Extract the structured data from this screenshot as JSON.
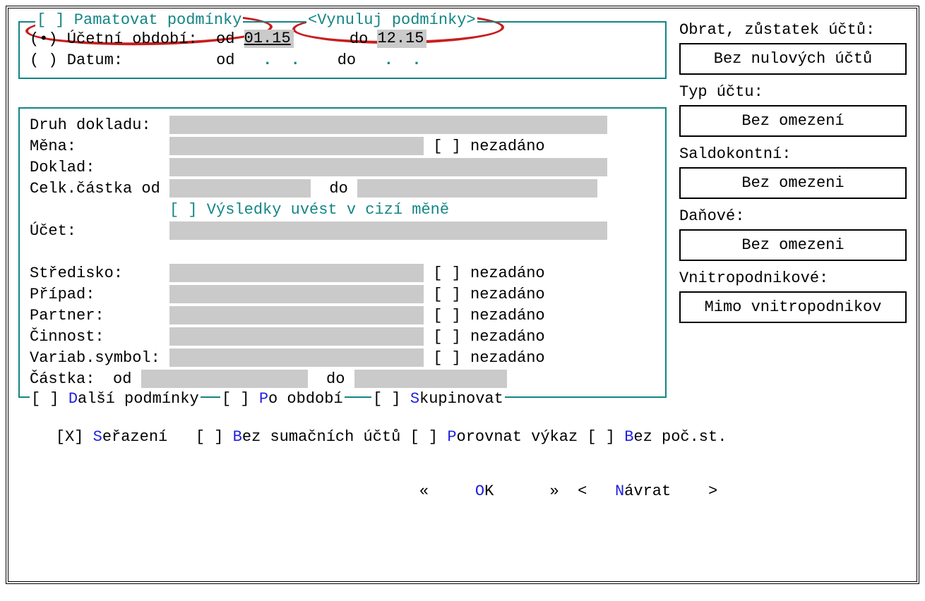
{
  "top": {
    "remember_checkbox": "[ ] Pamatovat podmínky",
    "reset_button": "<Vynuluj podmínky>",
    "radio_period_label": "(•) Účetní období:",
    "od_label": "od",
    "do_label": "do",
    "period_from": "01.15",
    "period_to": "12.15",
    "radio_date_label": "( ) Datum:"
  },
  "mid": {
    "druh_dokladu": "Druh dokladu:",
    "mena": "Měna:",
    "nezadano": "nezadáno",
    "doklad": "Doklad:",
    "celk_castka": "Celk.částka od",
    "do": "do",
    "foreign_currency": "[ ] Výsledky uvést v cizí měně",
    "ucet": "Účet:",
    "stredisko": "Středisko:",
    "pripad": "Případ:",
    "partner": "Partner:",
    "cinnost": "Činnost:",
    "variab": "Variab.symbol:",
    "castka": "Částka:",
    "od": "od"
  },
  "bottom_legends": {
    "dalsi": "[ ] ",
    "dalsi_hl": "D",
    "dalsi_rest": "alší podmínky",
    "po_obdobi": "[ ] ",
    "po_hl": "P",
    "po_rest": "o období",
    "skup": "[ ] ",
    "skup_hl": "S",
    "skup_rest": "kupinovat"
  },
  "footer1": {
    "serazeni_pre": "[X] ",
    "serazeni_hl": "S",
    "serazeni_rest": "eřazení",
    "bezsum_pre": "   [ ] ",
    "bezsum_hl": "B",
    "bezsum_rest": "ez sumačních účtů ",
    "porovnat_pre": "[ ] ",
    "porovnat_hl": "P",
    "porovnat_rest": "orovnat výkaz ",
    "bezpoc_pre": "[ ] ",
    "bezpoc_hl": "B",
    "bezpoc_rest": "ez poč.st."
  },
  "footer2": {
    "left_arrow": "«",
    "ok_hl": "O",
    "ok_rest": "K",
    "right_arrow": "»",
    "navrat_open": "<",
    "navrat_hl": "N",
    "navrat_rest": "ávrat",
    "navrat_close": ">"
  },
  "right": {
    "obrat_label": "Obrat, zůstatek účtů:",
    "obrat_btn": "Bez nulových účtů",
    "typ_label": "Typ účtu:",
    "typ_btn": "Bez omezení",
    "saldo_label": "Saldokontní:",
    "saldo_btn": "Bez omezeni",
    "danove_label": "Daňové:",
    "danove_btn": "Bez omezeni",
    "vnitro_label": "Vnitropodnikové:",
    "vnitro_btn": "Mimo vnitropodnikov"
  }
}
